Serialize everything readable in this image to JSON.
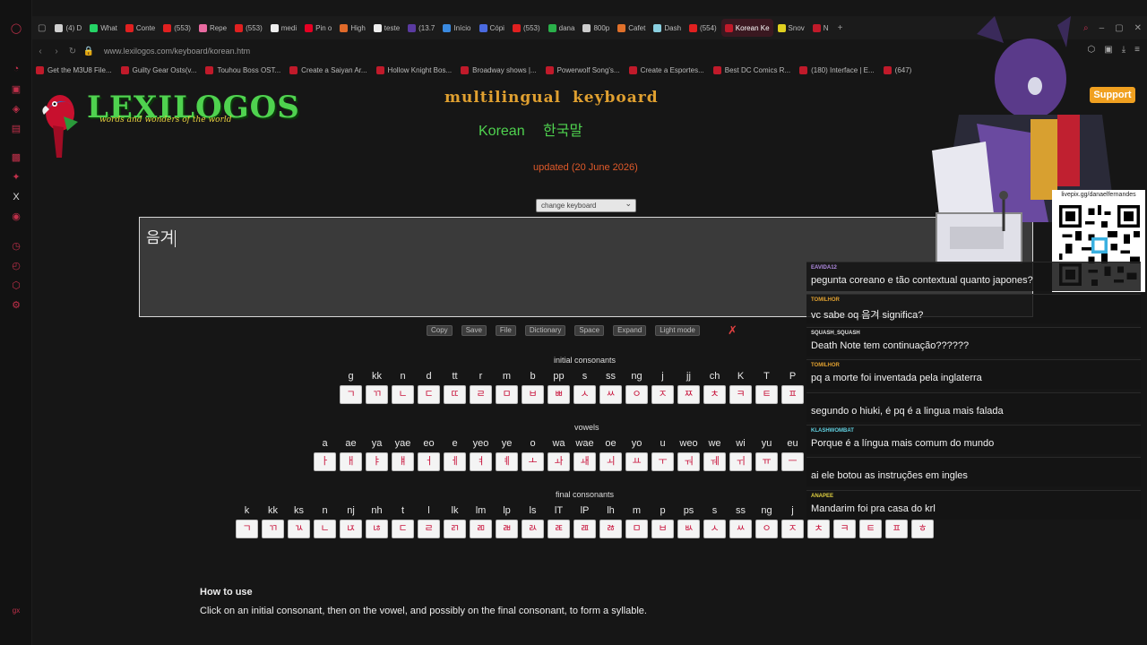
{
  "browser": {
    "tabs": [
      {
        "label": "(4) D",
        "color": "#cfcfcf"
      },
      {
        "label": "What",
        "color": "#25d366"
      },
      {
        "label": "Conte",
        "color": "#e02020"
      },
      {
        "label": "(553)",
        "color": "#e02020"
      },
      {
        "label": "Repe",
        "color": "#e86aa0"
      },
      {
        "label": "(553)",
        "color": "#e02020"
      },
      {
        "label": "medi",
        "color": "#eeeeee"
      },
      {
        "label": "Pin o",
        "color": "#e60023"
      },
      {
        "label": "High",
        "color": "#e06a2a"
      },
      {
        "label": "teste",
        "color": "#eeeeee"
      },
      {
        "label": "(13.7",
        "color": "#5a3aa0"
      },
      {
        "label": "Início",
        "color": "#3a8ae0"
      },
      {
        "label": "Cópi",
        "color": "#4a6ae0"
      },
      {
        "label": "(553)",
        "color": "#e02020"
      },
      {
        "label": "dana",
        "color": "#2ab04a"
      },
      {
        "label": "800p",
        "color": "#cccccc"
      },
      {
        "label": "Cafet",
        "color": "#e0702a"
      },
      {
        "label": "Dash",
        "color": "#8ad0e0"
      },
      {
        "label": "(554)",
        "color": "#e02020"
      },
      {
        "label": "Korean Ke",
        "color": "#c01a2a",
        "active": true
      },
      {
        "label": "Snov",
        "color": "#e0d020"
      },
      {
        "label": "N",
        "color": "#c01a2a"
      }
    ],
    "url": "www.lexilogos.com/keyboard/korean.htm",
    "bookmarks": [
      "Get the M3U8 File...",
      "Guilty Gear Osts(v...",
      "Touhou Boss OST...",
      "Create a Saiyan Ar...",
      "Hollow Knight Bos...",
      "Broadway shows |...",
      "Powerwolf Song's...",
      "Create a Esportes...",
      "Best DC Comics R...",
      "(180) Interface | E...",
      "(647)"
    ]
  },
  "site": {
    "logo_title": "LEXILOGOS",
    "logo_sub": "words and wonders of the world",
    "keyboard_title": "multilingual keyboard",
    "lang_en": "Korean",
    "lang_ko": "한국말",
    "updated": "updated (20 June 2026)",
    "select_value": "change keyboard",
    "text_value": "음겨"
  },
  "toolbar": {
    "copy": "Copy",
    "save": "Save",
    "file": "File",
    "dictionary": "Dictionary",
    "space": "Space",
    "expand": "Expand",
    "light_mode": "Light mode",
    "close": "✗"
  },
  "initial": {
    "label": "initial consonants",
    "keys": [
      {
        "lat": "g",
        "jamo": "ㄱ"
      },
      {
        "lat": "kk",
        "jamo": "ㄲ"
      },
      {
        "lat": "n",
        "jamo": "ㄴ"
      },
      {
        "lat": "d",
        "jamo": "ㄷ"
      },
      {
        "lat": "tt",
        "jamo": "ㄸ"
      },
      {
        "lat": "r",
        "jamo": "ㄹ"
      },
      {
        "lat": "m",
        "jamo": "ㅁ"
      },
      {
        "lat": "b",
        "jamo": "ㅂ"
      },
      {
        "lat": "pp",
        "jamo": "ㅃ"
      },
      {
        "lat": "s",
        "jamo": "ㅅ"
      },
      {
        "lat": "ss",
        "jamo": "ㅆ"
      },
      {
        "lat": "ng",
        "jamo": "ㅇ"
      },
      {
        "lat": "j",
        "jamo": "ㅈ"
      },
      {
        "lat": "jj",
        "jamo": "ㅉ"
      },
      {
        "lat": "ch",
        "jamo": "ㅊ"
      },
      {
        "lat": "K",
        "jamo": "ㅋ"
      },
      {
        "lat": "T",
        "jamo": "ㅌ"
      },
      {
        "lat": "P",
        "jamo": "ㅍ"
      }
    ]
  },
  "vowels": {
    "label": "vowels",
    "keys": [
      {
        "lat": "a",
        "jamo": "ㅏ"
      },
      {
        "lat": "ae",
        "jamo": "ㅐ"
      },
      {
        "lat": "ya",
        "jamo": "ㅑ"
      },
      {
        "lat": "yae",
        "jamo": "ㅒ"
      },
      {
        "lat": "eo",
        "jamo": "ㅓ"
      },
      {
        "lat": "e",
        "jamo": "ㅔ"
      },
      {
        "lat": "yeo",
        "jamo": "ㅕ"
      },
      {
        "lat": "ye",
        "jamo": "ㅖ"
      },
      {
        "lat": "o",
        "jamo": "ㅗ"
      },
      {
        "lat": "wa",
        "jamo": "ㅘ"
      },
      {
        "lat": "wae",
        "jamo": "ㅙ"
      },
      {
        "lat": "oe",
        "jamo": "ㅚ"
      },
      {
        "lat": "yo",
        "jamo": "ㅛ"
      },
      {
        "lat": "u",
        "jamo": "ㅜ"
      },
      {
        "lat": "weo",
        "jamo": "ㅝ"
      },
      {
        "lat": "we",
        "jamo": "ㅞ"
      },
      {
        "lat": "wi",
        "jamo": "ㅟ"
      },
      {
        "lat": "yu",
        "jamo": "ㅠ"
      },
      {
        "lat": "eu",
        "jamo": "ㅡ"
      }
    ]
  },
  "finals": {
    "label": "final consonants",
    "keys": [
      {
        "lat": "k",
        "jamo": "ㄱ"
      },
      {
        "lat": "kk",
        "jamo": "ㄲ"
      },
      {
        "lat": "ks",
        "jamo": "ㄳ"
      },
      {
        "lat": "n",
        "jamo": "ㄴ"
      },
      {
        "lat": "nj",
        "jamo": "ㄵ"
      },
      {
        "lat": "nh",
        "jamo": "ㄶ"
      },
      {
        "lat": "t",
        "jamo": "ㄷ"
      },
      {
        "lat": "l",
        "jamo": "ㄹ"
      },
      {
        "lat": "lk",
        "jamo": "ㄺ"
      },
      {
        "lat": "lm",
        "jamo": "ㄻ"
      },
      {
        "lat": "lp",
        "jamo": "ㄼ"
      },
      {
        "lat": "ls",
        "jamo": "ㄽ"
      },
      {
        "lat": "lT",
        "jamo": "ㄾ"
      },
      {
        "lat": "lP",
        "jamo": "ㄿ"
      },
      {
        "lat": "lh",
        "jamo": "ㅀ"
      },
      {
        "lat": "m",
        "jamo": "ㅁ"
      },
      {
        "lat": "p",
        "jamo": "ㅂ"
      },
      {
        "lat": "ps",
        "jamo": "ㅄ"
      },
      {
        "lat": "s",
        "jamo": "ㅅ"
      },
      {
        "lat": "ss",
        "jamo": "ㅆ"
      },
      {
        "lat": "ng",
        "jamo": "ㅇ"
      },
      {
        "lat": "j",
        "jamo": "ㅈ"
      },
      {
        "lat": "",
        "jamo": "ㅊ"
      },
      {
        "lat": "",
        "jamo": "ㅋ"
      },
      {
        "lat": "",
        "jamo": "ㅌ"
      },
      {
        "lat": "",
        "jamo": "ㅍ"
      },
      {
        "lat": "",
        "jamo": "ㅎ"
      }
    ]
  },
  "howto": {
    "heading": "How to use",
    "text": "Click on an initial consonant, then on the vowel, and possibly on the final consonant, to form a syllable."
  },
  "stream": {
    "support_label": "Support",
    "livepix_label": "livepix.gg/danaelfernandes",
    "chat": [
      {
        "user": "EAVIDA12",
        "color": "#b08ae0",
        "text": "pegunta coreano e tão contextual quanto japones?"
      },
      {
        "user": "TOMILHOR",
        "color": "#e0a030",
        "text": "vc sabe oq 음겨 significa?"
      },
      {
        "user": "SQUASH_SQUASH",
        "color": "#e0e0e0",
        "text": "Death Note tem continuação??????"
      },
      {
        "user": "TOMILHOR",
        "color": "#e0a030",
        "text": "pq a morte foi inventada pela inglaterra"
      },
      {
        "user": "",
        "color": "#e0e0e0",
        "text": "segundo o hiuki, é pq é a lingua mais falada"
      },
      {
        "user": "KLASHWOMBAT",
        "color": "#60d0e0",
        "text": "Porque é a língua mais comum do mundo"
      },
      {
        "user": "",
        "color": "#e0e0e0",
        "text": "ai ele botou as instruções em ingles"
      },
      {
        "user": "ANAPEE",
        "color": "#e0d040",
        "text": "Mandarim foi pra casa do krl"
      }
    ]
  }
}
